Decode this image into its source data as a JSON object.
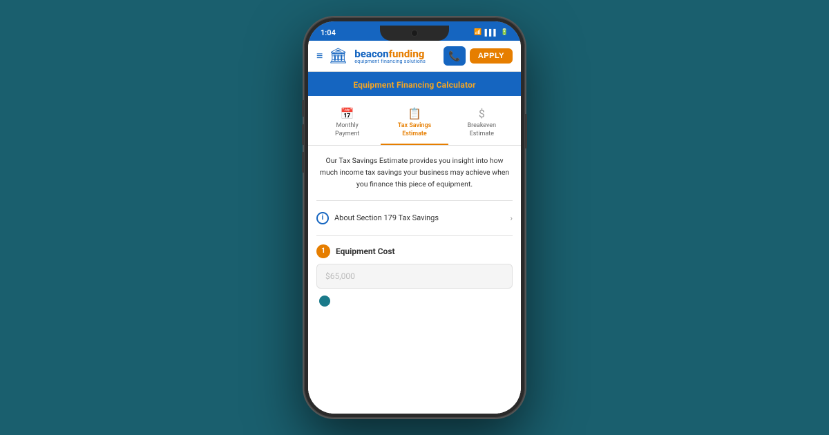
{
  "statusBar": {
    "time": "1:04",
    "wifi": "WiFi",
    "signal": "Signal",
    "battery": "Battery"
  },
  "header": {
    "logoBeaconPart1": "beacon",
    "logoBeaconPart2": "funding",
    "logoTagline": "equipment financing solutions",
    "phoneButtonLabel": "📞",
    "applyButtonLabel": "APPLY"
  },
  "calcHeader": {
    "title": "Equipment Financing Calculator"
  },
  "tabs": [
    {
      "id": "monthly-payment",
      "icon": "📅",
      "label": "Monthly\nPayment",
      "active": false
    },
    {
      "id": "tax-savings",
      "icon": "📋",
      "label": "Tax Savings\nEstimate",
      "active": true
    },
    {
      "id": "breakeven",
      "icon": "$",
      "label": "Breakeven\nEstimate",
      "active": false
    }
  ],
  "content": {
    "description": "Our Tax Savings Estimate provides you insight into how much income tax savings your business may achieve when you finance this piece of equipment.",
    "sectionLink": {
      "text": "About Section 179 Tax Savings"
    },
    "equipmentCost": {
      "stepNumber": "1",
      "label": "Equipment Cost",
      "inputPlaceholder": "$65,000"
    }
  }
}
